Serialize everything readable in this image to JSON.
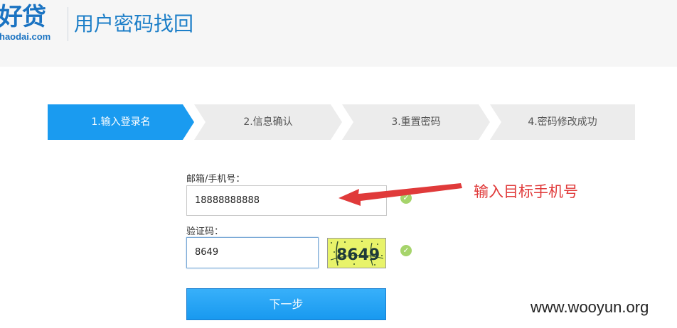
{
  "header": {
    "logo_main": "好贷",
    "logo_domain": "haodai.com",
    "page_title": "用户密码找回"
  },
  "steps": [
    {
      "label": "1.输入登录名",
      "active": true
    },
    {
      "label": "2.信息确认",
      "active": false
    },
    {
      "label": "3.重置密码",
      "active": false
    },
    {
      "label": "4.密码修改成功",
      "active": false
    }
  ],
  "form": {
    "account_label": "邮箱/手机号：",
    "account_value": "18888888888",
    "captcha_label": "验证码：",
    "captcha_value": "8649",
    "captcha_image_text": "8649",
    "next_button": "下一步"
  },
  "annotation": {
    "text": "输入目标手机号",
    "color": "#e03a3a"
  },
  "watermark": "www.wooyun.org",
  "colors": {
    "accent": "#1a9bf0",
    "step_inactive": "#ececec",
    "success": "#a6d46b"
  }
}
